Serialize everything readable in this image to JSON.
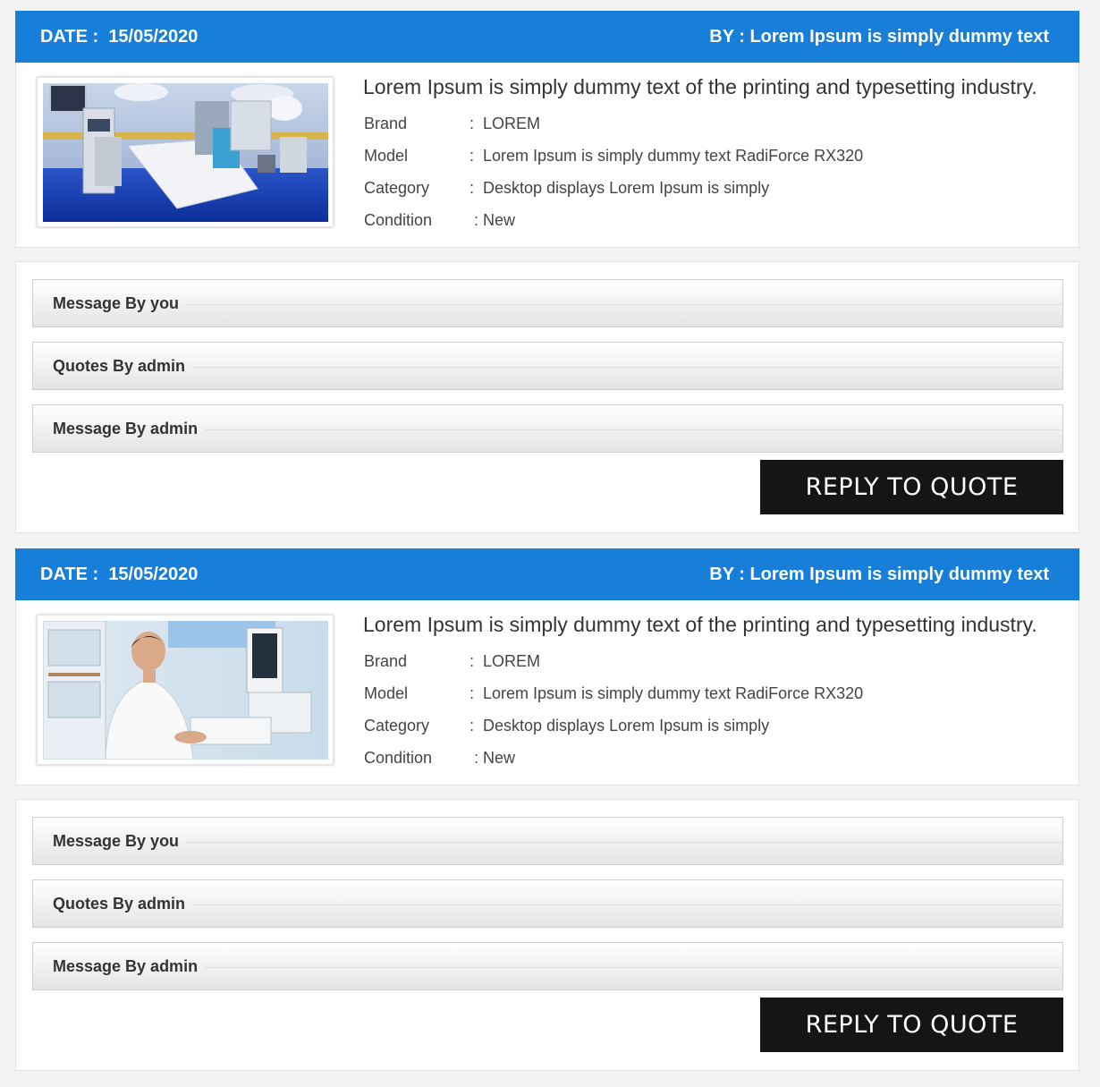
{
  "quotes": [
    {
      "date_label": "DATE :",
      "date": "15/05/2020",
      "by_text": "BY : Lorem Ipsum is simply dummy text",
      "image_icon": "operating-room-photo",
      "title": "Lorem Ipsum is simply dummy text of the printing and typesetting industry.",
      "specs": [
        {
          "label": "Brand",
          "value": "LOREM"
        },
        {
          "label": "Model",
          "value": "Lorem Ipsum is simply dummy text RadiForce RX320"
        },
        {
          "label": "Category",
          "value": "Desktop displays Lorem Ipsum is simply"
        },
        {
          "label": "Condition",
          "value": "New"
        }
      ],
      "messages": [
        "Message By you",
        "Quotes By admin",
        "Message By admin"
      ],
      "reply_label": "REPLY TO QUOTE"
    },
    {
      "date_label": "DATE :",
      "date": "15/05/2020",
      "by_text": "BY : Lorem Ipsum is simply dummy text",
      "image_icon": "doctor-ultrasound-photo",
      "title": "Lorem Ipsum is simply dummy text of the printing and typesetting industry.",
      "specs": [
        {
          "label": "Brand",
          "value": "LOREM"
        },
        {
          "label": "Model",
          "value": "Lorem Ipsum is simply dummy text RadiForce RX320"
        },
        {
          "label": "Category",
          "value": "Desktop displays Lorem Ipsum is simply"
        },
        {
          "label": "Condition",
          "value": "New"
        }
      ],
      "messages": [
        "Message By you",
        "Quotes By admin",
        "Message By admin"
      ],
      "reply_label": "REPLY TO QUOTE"
    }
  ],
  "colors": {
    "header_blue": "#177ed9",
    "button_black": "#151515",
    "page_bg": "#f3f3f3"
  }
}
